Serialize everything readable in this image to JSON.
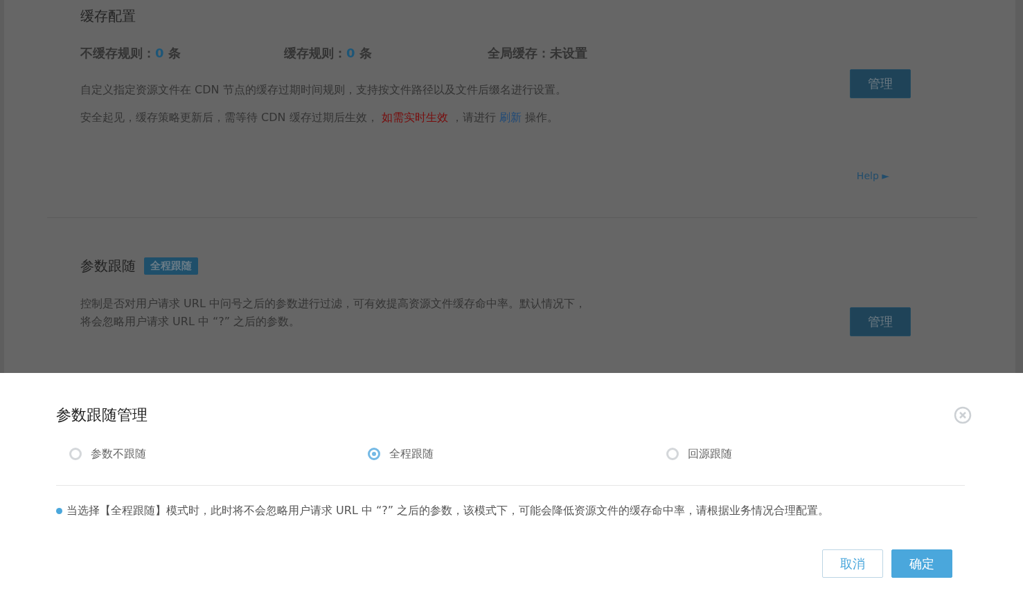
{
  "cache_config": {
    "title": "缓存配置",
    "stats": [
      {
        "label": "不缓存规则：",
        "value": "0",
        "unit": "条",
        "kind": "count"
      },
      {
        "label": "缓存规则：",
        "value": "0",
        "unit": "条",
        "kind": "count"
      },
      {
        "label": "全局缓存：",
        "value": "未设置",
        "kind": "status"
      }
    ],
    "description": "自定义指定资源文件在 CDN 节点的缓存过期时间规则，支持按文件路径以及文件后缀名进行设置。",
    "note": {
      "before": "安全起见，缓存策略更新后，需等待 CDN 缓存过期后生效，",
      "realtime_link": "如需实时生效",
      "middle": "，请进行",
      "refresh_link": "刷新",
      "after": "操作。"
    },
    "manage_button": "管理",
    "help_link": "Help ►"
  },
  "param_follow": {
    "title": "参数跟随",
    "badge": "全程跟随",
    "description_lines": [
      "控制是否对用户请求 URL 中问号之后的参数进行过滤，可有效提高资源文件缓存命中率。默认情况下，",
      "将会忽略用户请求 URL 中 “?” 之后的参数。"
    ],
    "manage_button": "管理"
  },
  "dialog": {
    "title": "参数跟随管理",
    "options": [
      {
        "label": "参数不跟随",
        "selected": false
      },
      {
        "label": "全程跟随",
        "selected": true
      },
      {
        "label": "回源跟随",
        "selected": false
      }
    ],
    "hint": "当选择【全程跟随】模式时，此时将不会忽略用户请求 URL 中 “?” 之后的参数，该模式下，可能会降低资源文件的缓存命中率，请根据业务情况合理配置。",
    "buttons": {
      "cancel": "取消",
      "confirm": "确定"
    }
  }
}
